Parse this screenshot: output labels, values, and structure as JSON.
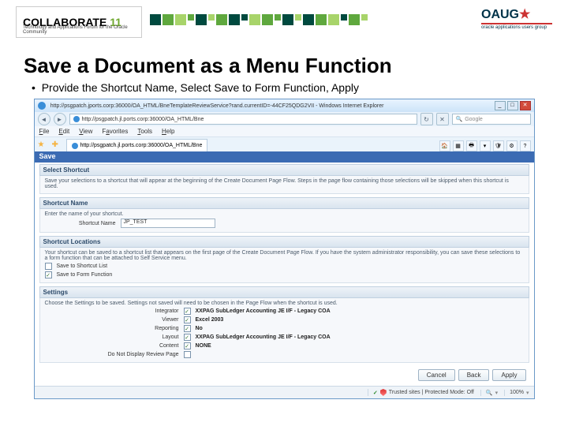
{
  "logos": {
    "collab_text": "COLLABORATE",
    "collab_year": "11",
    "collab_sub": "Technology and Applications Forum for the Oracle Community",
    "oaug": "OAUG",
    "oaug_sub": "oracle applications users group"
  },
  "slide": {
    "title": "Save a Document as a Menu Function",
    "bullet": "Provide the Shortcut Name, Select Save to Form Function, Apply"
  },
  "browser": {
    "title": "http://psgpatch.jports.corp:36000/OA_HTML/BneTemplateReviewService?rand.currentID=-44CF25QDG2VII - Windows Internet Explorer",
    "address": "http://psgpatch.jl.ports.corp:36000/OA_HTML/Bne",
    "search_placeholder": "Google",
    "menu": {
      "file": "File",
      "edit": "Edit",
      "view": "View",
      "favorites": "Favorites",
      "tools": "Tools",
      "help": "Help"
    },
    "tab_label": "http://psgpatch.jl.ports.corp:36000/OA_HTML/Bne"
  },
  "page": {
    "head": "Save",
    "select_shortcut": {
      "title": "Select Shortcut",
      "help": "Save your selections to a shortcut that will appear at the beginning of the Create Document Page Flow. Steps in the page flow containing those selections will be skipped when this shortcut is used."
    },
    "shortcut_name": {
      "title": "Shortcut Name",
      "help": "Enter the name of your shortcut.",
      "label": "Shortcut Name",
      "value": "JP_TEST"
    },
    "shortcut_locations": {
      "title": "Shortcut Locations",
      "help": "Your shortcut can be saved to a shortcut list that appears on the first page of the Create Document Page Flow. If you have the system administrator responsibility, you can save these selections to a form function that can be attached to Self Service menu.",
      "cb1": "Save to Shortcut List",
      "cb2": "Save to Form Function"
    },
    "settings": {
      "title": "Settings",
      "help": "Choose the Settings to be saved. Settings not saved will need to be chosen in the Page Flow when the shortcut is used.",
      "rows": {
        "integrator": {
          "label": "Integrator",
          "value": "XXPAG SubLedger Accounting JE I/F - Legacy COA"
        },
        "viewer": {
          "label": "Viewer",
          "value": "Excel 2003"
        },
        "reporting": {
          "label": "Reporting",
          "value": "No"
        },
        "layout": {
          "label": "Layout",
          "value": "XXPAG SubLedger Accounting JE I/F - Legacy COA"
        },
        "content": {
          "label": "Content",
          "value": "NONE"
        },
        "no_review": {
          "label": "Do Not Display Review Page",
          "value": ""
        }
      }
    },
    "buttons": {
      "cancel": "Cancel",
      "back": "Back",
      "apply": "Apply"
    }
  },
  "statusbar": {
    "trusted": "Trusted sites | Protected Mode: Off",
    "zoom": "100%"
  }
}
